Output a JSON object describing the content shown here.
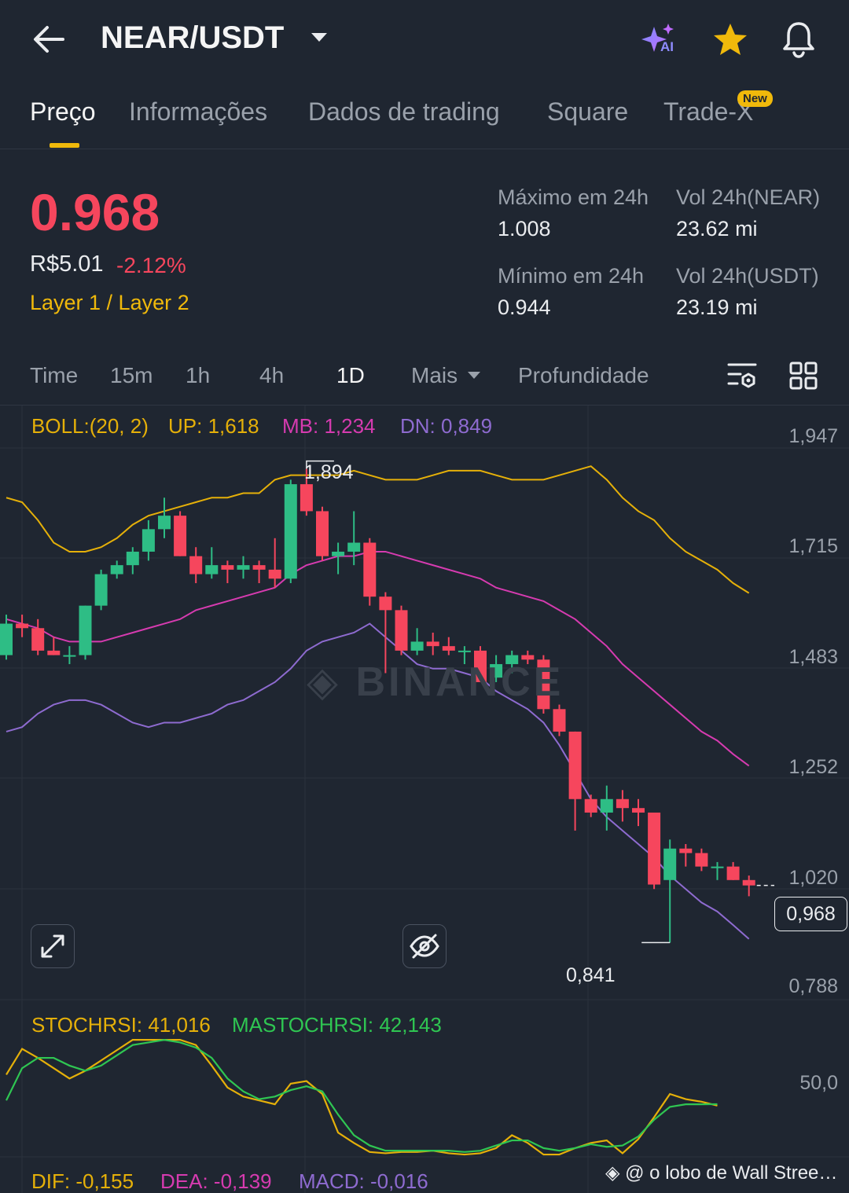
{
  "header": {
    "pair": "NEAR/USDT",
    "ai_label": "AI"
  },
  "tabs": [
    {
      "label": "Preço",
      "active": true
    },
    {
      "label": "Informações"
    },
    {
      "label": "Dados de trading"
    },
    {
      "label": "Square"
    },
    {
      "label": "Trade-X",
      "badge": "New"
    }
  ],
  "ticker": {
    "price": "0.968",
    "fiat": "R$5.01",
    "change": "-2.12%",
    "tag": "Layer 1 / Layer 2",
    "high_label": "Máximo em 24h",
    "high_value": "1.008",
    "low_label": "Mínimo em 24h",
    "low_value": "0.944",
    "vol_base_label": "Vol 24h(NEAR)",
    "vol_base_value": "23.62 mi",
    "vol_quote_label": "Vol 24h(USDT)",
    "vol_quote_value": "23.19 mi"
  },
  "timeframes": {
    "items": [
      "Time",
      "15m",
      "1h",
      "4h",
      "1D"
    ],
    "more": "Mais",
    "depth": "Profundidade",
    "active": "1D"
  },
  "indicators": {
    "boll": {
      "label": "BOLL:(20, 2)",
      "up": "UP: 1,618",
      "mb": "MB: 1,234",
      "dn": "DN: 0,849"
    },
    "stoch": {
      "k": "STOCHRSI: 41,016",
      "d": "MASTOCHRSI: 42,143"
    },
    "macd": {
      "dif": "DIF: -0,155",
      "dea": "DEA: -0,139",
      "macd": "MACD: -0,016"
    }
  },
  "colors": {
    "up": "#2ebd85",
    "down": "#f6465d",
    "accent": "#f0b90b",
    "boll_up": "#e5b009",
    "boll_mb": "#d63bb0",
    "boll_dn": "#8e6bd0",
    "stoch_k": "#e5b009",
    "stoch_d": "#2fc652"
  },
  "chart_data": [
    {
      "type": "candlestick",
      "price_axis_labels": [
        "1,947",
        "1,715",
        "1,483",
        "1,252",
        "1,020",
        "0,788"
      ],
      "ylim": [
        0.77,
        1.965
      ],
      "max_label": "1,894",
      "min_label": "0,841",
      "current_label": "0,968",
      "candles": [
        {
          "o": 1.48,
          "h": 1.57,
          "l": 1.47,
          "c": 1.55
        },
        {
          "o": 1.55,
          "h": 1.57,
          "l": 1.52,
          "c": 1.54
        },
        {
          "o": 1.54,
          "h": 1.56,
          "l": 1.48,
          "c": 1.49
        },
        {
          "o": 1.49,
          "h": 1.52,
          "l": 1.48,
          "c": 1.48
        },
        {
          "o": 1.48,
          "h": 1.5,
          "l": 1.46,
          "c": 1.48
        },
        {
          "o": 1.48,
          "h": 1.59,
          "l": 1.47,
          "c": 1.59
        },
        {
          "o": 1.59,
          "h": 1.67,
          "l": 1.58,
          "c": 1.66
        },
        {
          "o": 1.66,
          "h": 1.69,
          "l": 1.65,
          "c": 1.68
        },
        {
          "o": 1.68,
          "h": 1.72,
          "l": 1.66,
          "c": 1.71
        },
        {
          "o": 1.71,
          "h": 1.78,
          "l": 1.69,
          "c": 1.76
        },
        {
          "o": 1.76,
          "h": 1.83,
          "l": 1.74,
          "c": 1.79
        },
        {
          "o": 1.79,
          "h": 1.8,
          "l": 1.7,
          "c": 1.7
        },
        {
          "o": 1.7,
          "h": 1.72,
          "l": 1.64,
          "c": 1.66
        },
        {
          "o": 1.66,
          "h": 1.72,
          "l": 1.65,
          "c": 1.68
        },
        {
          "o": 1.68,
          "h": 1.69,
          "l": 1.64,
          "c": 1.67
        },
        {
          "o": 1.67,
          "h": 1.7,
          "l": 1.65,
          "c": 1.68
        },
        {
          "o": 1.68,
          "h": 1.69,
          "l": 1.64,
          "c": 1.67
        },
        {
          "o": 1.67,
          "h": 1.74,
          "l": 1.63,
          "c": 1.65
        },
        {
          "o": 1.65,
          "h": 1.87,
          "l": 1.64,
          "c": 1.86
        },
        {
          "o": 1.86,
          "h": 1.894,
          "l": 1.79,
          "c": 1.8
        },
        {
          "o": 1.8,
          "h": 1.81,
          "l": 1.69,
          "c": 1.7
        },
        {
          "o": 1.7,
          "h": 1.73,
          "l": 1.66,
          "c": 1.71
        },
        {
          "o": 1.71,
          "h": 1.8,
          "l": 1.68,
          "c": 1.73
        },
        {
          "o": 1.73,
          "h": 1.74,
          "l": 1.59,
          "c": 1.61
        },
        {
          "o": 1.61,
          "h": 1.62,
          "l": 1.44,
          "c": 1.58
        },
        {
          "o": 1.58,
          "h": 1.59,
          "l": 1.48,
          "c": 1.49
        },
        {
          "o": 1.49,
          "h": 1.54,
          "l": 1.48,
          "c": 1.51
        },
        {
          "o": 1.51,
          "h": 1.53,
          "l": 1.48,
          "c": 1.5
        },
        {
          "o": 1.5,
          "h": 1.52,
          "l": 1.48,
          "c": 1.49
        },
        {
          "o": 1.49,
          "h": 1.5,
          "l": 1.46,
          "c": 1.49
        },
        {
          "o": 1.49,
          "h": 1.5,
          "l": 1.42,
          "c": 1.42
        },
        {
          "o": 1.43,
          "h": 1.48,
          "l": 1.42,
          "c": 1.46
        },
        {
          "o": 1.46,
          "h": 1.49,
          "l": 1.44,
          "c": 1.48
        },
        {
          "o": 1.48,
          "h": 1.49,
          "l": 1.46,
          "c": 1.47
        },
        {
          "o": 1.47,
          "h": 1.48,
          "l": 1.35,
          "c": 1.36
        },
        {
          "o": 1.36,
          "h": 1.37,
          "l": 1.3,
          "c": 1.31
        },
        {
          "o": 1.31,
          "h": 1.31,
          "l": 1.09,
          "c": 1.16
        },
        {
          "o": 1.16,
          "h": 1.17,
          "l": 1.12,
          "c": 1.13
        },
        {
          "o": 1.13,
          "h": 1.19,
          "l": 1.09,
          "c": 1.16
        },
        {
          "o": 1.16,
          "h": 1.18,
          "l": 1.11,
          "c": 1.14
        },
        {
          "o": 1.14,
          "h": 1.16,
          "l": 1.1,
          "c": 1.13
        },
        {
          "o": 1.13,
          "h": 1.13,
          "l": 0.96,
          "c": 0.97
        },
        {
          "o": 0.98,
          "h": 1.07,
          "l": 0.841,
          "c": 1.05
        },
        {
          "o": 1.05,
          "h": 1.06,
          "l": 1.01,
          "c": 1.04
        },
        {
          "o": 1.04,
          "h": 1.05,
          "l": 1.0,
          "c": 1.01
        },
        {
          "o": 1.01,
          "h": 1.02,
          "l": 0.98,
          "c": 1.01
        },
        {
          "o": 1.01,
          "h": 1.02,
          "l": 0.98,
          "c": 0.98
        },
        {
          "o": 0.98,
          "h": 0.99,
          "l": 0.944,
          "c": 0.968
        }
      ],
      "boll_up": [
        1.83,
        1.82,
        1.78,
        1.73,
        1.71,
        1.71,
        1.72,
        1.74,
        1.77,
        1.79,
        1.8,
        1.81,
        1.82,
        1.83,
        1.83,
        1.84,
        1.84,
        1.87,
        1.88,
        1.88,
        1.88,
        1.88,
        1.89,
        1.88,
        1.87,
        1.87,
        1.87,
        1.88,
        1.89,
        1.89,
        1.89,
        1.88,
        1.87,
        1.87,
        1.87,
        1.88,
        1.89,
        1.9,
        1.87,
        1.83,
        1.8,
        1.78,
        1.74,
        1.71,
        1.69,
        1.67,
        1.64,
        1.618
      ],
      "boll_mb": [
        1.56,
        1.55,
        1.54,
        1.52,
        1.51,
        1.51,
        1.51,
        1.52,
        1.53,
        1.54,
        1.55,
        1.56,
        1.58,
        1.59,
        1.6,
        1.61,
        1.62,
        1.63,
        1.66,
        1.68,
        1.69,
        1.7,
        1.7,
        1.71,
        1.71,
        1.7,
        1.69,
        1.68,
        1.67,
        1.66,
        1.65,
        1.63,
        1.62,
        1.61,
        1.6,
        1.58,
        1.56,
        1.53,
        1.5,
        1.46,
        1.43,
        1.4,
        1.37,
        1.34,
        1.31,
        1.29,
        1.26,
        1.234
      ],
      "boll_dn": [
        1.31,
        1.32,
        1.35,
        1.37,
        1.38,
        1.38,
        1.37,
        1.35,
        1.33,
        1.32,
        1.33,
        1.33,
        1.34,
        1.35,
        1.37,
        1.38,
        1.4,
        1.42,
        1.45,
        1.49,
        1.51,
        1.52,
        1.53,
        1.55,
        1.52,
        1.49,
        1.46,
        1.45,
        1.45,
        1.44,
        1.43,
        1.4,
        1.38,
        1.36,
        1.33,
        1.28,
        1.22,
        1.16,
        1.12,
        1.09,
        1.06,
        1.03,
        0.99,
        0.96,
        0.93,
        0.91,
        0.88,
        0.849
      ]
    },
    {
      "type": "line",
      "axis_labels": [
        "50,0"
      ],
      "ylim": [
        0,
        100
      ],
      "series": [
        {
          "name": "STOCHRSI",
          "values": [
            65,
            85,
            78,
            70,
            62,
            68,
            76,
            84,
            92,
            92,
            92,
            92,
            88,
            72,
            55,
            48,
            45,
            42,
            58,
            60,
            50,
            20,
            12,
            5,
            4,
            5,
            5,
            6,
            4,
            3,
            4,
            8,
            18,
            12,
            3,
            3,
            8,
            12,
            14,
            4,
            15,
            32,
            50,
            46,
            44,
            41
          ]
        },
        {
          "name": "MASTOCHRSI",
          "values": [
            45,
            70,
            78,
            78,
            72,
            68,
            72,
            80,
            88,
            90,
            92,
            90,
            86,
            78,
            62,
            52,
            46,
            48,
            53,
            56,
            52,
            34,
            18,
            10,
            6,
            6,
            6,
            6,
            6,
            5,
            6,
            10,
            14,
            14,
            8,
            6,
            8,
            11,
            9,
            10,
            17,
            30,
            40,
            42,
            42,
            42.1
          ]
        }
      ]
    }
  ]
}
